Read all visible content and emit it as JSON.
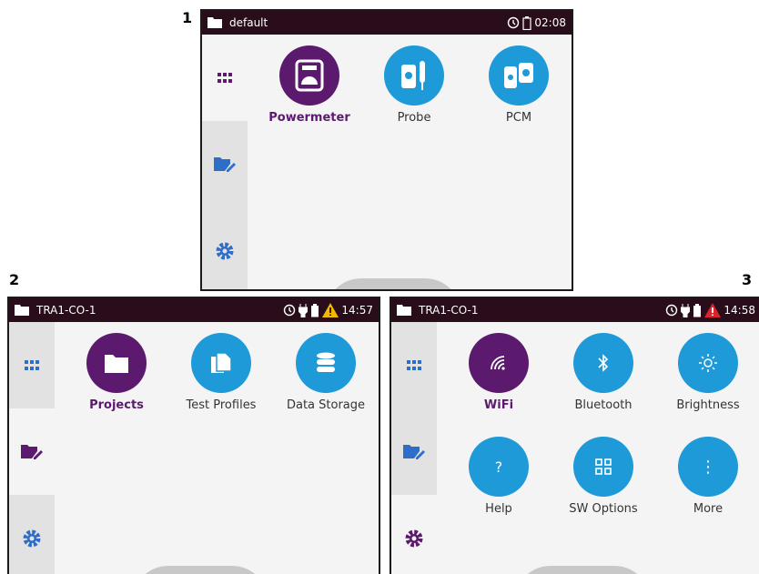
{
  "labels": {
    "one": "1",
    "two": "2",
    "three": "3"
  },
  "screen1": {
    "title": "default",
    "time": "02:08",
    "apps": [
      {
        "label": "Powermeter",
        "icon": "powermeter-icon"
      },
      {
        "label": "Probe",
        "icon": "probe-icon"
      },
      {
        "label": "PCM",
        "icon": "pcm-icon"
      }
    ]
  },
  "screen2": {
    "title": "TRA1-CO-1",
    "time": "14:57",
    "apps": [
      {
        "label": "Projects",
        "icon": "folder-icon"
      },
      {
        "label": "Test Profiles",
        "icon": "test-profiles-icon"
      },
      {
        "label": "Data Storage",
        "icon": "database-icon"
      }
    ]
  },
  "screen3": {
    "title": "TRA1-CO-1",
    "time": "14:58",
    "apps": [
      {
        "label": "WiFi",
        "icon": "wifi-icon"
      },
      {
        "label": "Bluetooth",
        "icon": "bluetooth-icon"
      },
      {
        "label": "Brightness",
        "icon": "brightness-icon"
      },
      {
        "label": "Help",
        "icon": "help-icon"
      },
      {
        "label": "SW Options",
        "icon": "sw-options-icon"
      },
      {
        "label": "More",
        "icon": "more-icon"
      }
    ],
    "help_glyph": "?",
    "more_glyph": "⋮"
  },
  "colors": {
    "accent_purple": "#5b1a6e",
    "accent_blue": "#1e9ad8",
    "statusbar": "#2a0d1a",
    "warning": "#f5b800",
    "alert": "#d9232e"
  }
}
